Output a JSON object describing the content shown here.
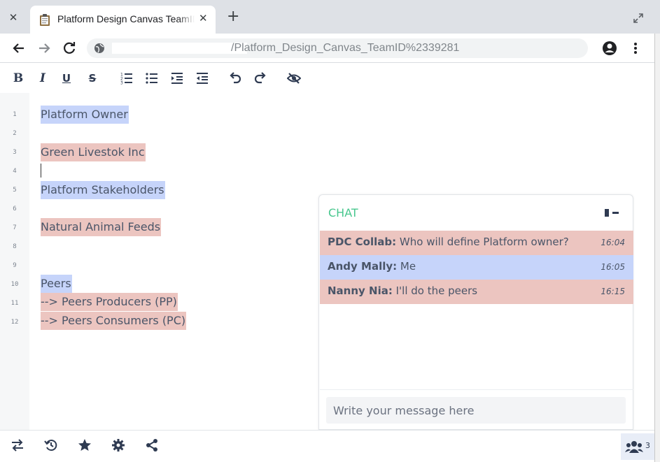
{
  "browser": {
    "tab_title": "Platform Design Canvas TeamID",
    "url_path": "/Platform_Design_Canvas_TeamID%2339281"
  },
  "editor": {
    "line_numbers": [
      "1",
      "2",
      "3",
      "4",
      "5",
      "6",
      "7",
      "8",
      "9",
      "10",
      "11",
      "12"
    ],
    "lines": [
      {
        "text": "Platform Owner",
        "highlight": "blue"
      },
      {
        "text": "Green Livestok Inc",
        "highlight": "pink"
      },
      {
        "text": "Platform Stakeholders",
        "highlight": "blue"
      },
      {
        "text": "Natural Animal Feeds",
        "highlight": "pink"
      },
      {
        "text": "Peers",
        "highlight": "blue"
      },
      {
        "text": "--> Peers Producers (PP)",
        "highlight": "pink"
      },
      {
        "text": "--> Peers Consumers (PC)",
        "highlight": "pink"
      }
    ]
  },
  "chat": {
    "title": "CHAT",
    "messages": [
      {
        "author": "PDC Collab:",
        "text": " Who will define Platform owner?",
        "time": "16:04"
      },
      {
        "author": "Andy Mally:",
        "text": " Me",
        "time": "16:05"
      },
      {
        "author": "Nanny Nia:",
        "text": " I'll do the peers",
        "time": "16:15"
      }
    ],
    "input_placeholder": "Write your message here"
  },
  "bottom_bar": {
    "user_count": "3"
  },
  "colors": {
    "highlight_blue": "#c6d4fa",
    "highlight_pink": "#ecc5c0",
    "chat_title": "#48c78e",
    "icon": "#2f3b52"
  }
}
